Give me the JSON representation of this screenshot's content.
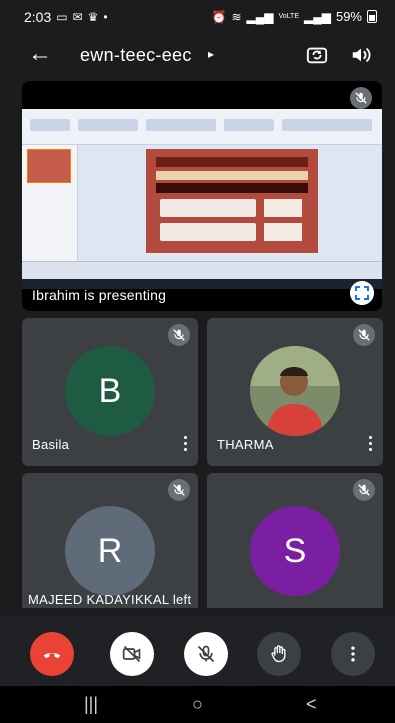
{
  "status_bar": {
    "time": "2:03",
    "battery": "59%",
    "network_label": "VoLTE"
  },
  "app_bar": {
    "title": "ewn-teec-eec",
    "title_caret": "▸",
    "back_icon": "arrow-left-icon",
    "switch_camera_icon": "switch-camera-icon",
    "speaker_icon": "speaker-icon"
  },
  "presentation": {
    "label": "Ibrahim is presenting",
    "muted": true,
    "fullscreen_icon": "fullscreen-icon"
  },
  "participants": [
    {
      "name": "Basila",
      "initial": "B",
      "avatar_color": "#1e5b42",
      "muted": true,
      "has_photo": false
    },
    {
      "name": "THARMA",
      "initial": "",
      "avatar_color": "#6c7a5a",
      "muted": true,
      "has_photo": true
    },
    {
      "name": "",
      "initial": "R",
      "avatar_color": "#5f6b78",
      "muted": true,
      "has_photo": false
    },
    {
      "name": "",
      "initial": "S",
      "avatar_color": "#7b1fa2",
      "muted": true,
      "has_photo": false
    }
  ],
  "toast": "MAJEED KADAYIKKAL left",
  "controls": [
    {
      "name": "end-call",
      "icon": "phone-hangup-icon",
      "color": "#ea4335"
    },
    {
      "name": "camera-toggle",
      "icon": "camera-off-icon",
      "color": "#ffffff"
    },
    {
      "name": "mic-toggle",
      "icon": "mic-off-icon",
      "color": "#ffffff"
    },
    {
      "name": "raise-hand",
      "icon": "hand-icon",
      "color": "#3c4043"
    },
    {
      "name": "more-options",
      "icon": "more-vertical-icon",
      "color": "#3c4043"
    }
  ],
  "nav": {
    "recents": "|||",
    "home": "○",
    "back": "<"
  }
}
